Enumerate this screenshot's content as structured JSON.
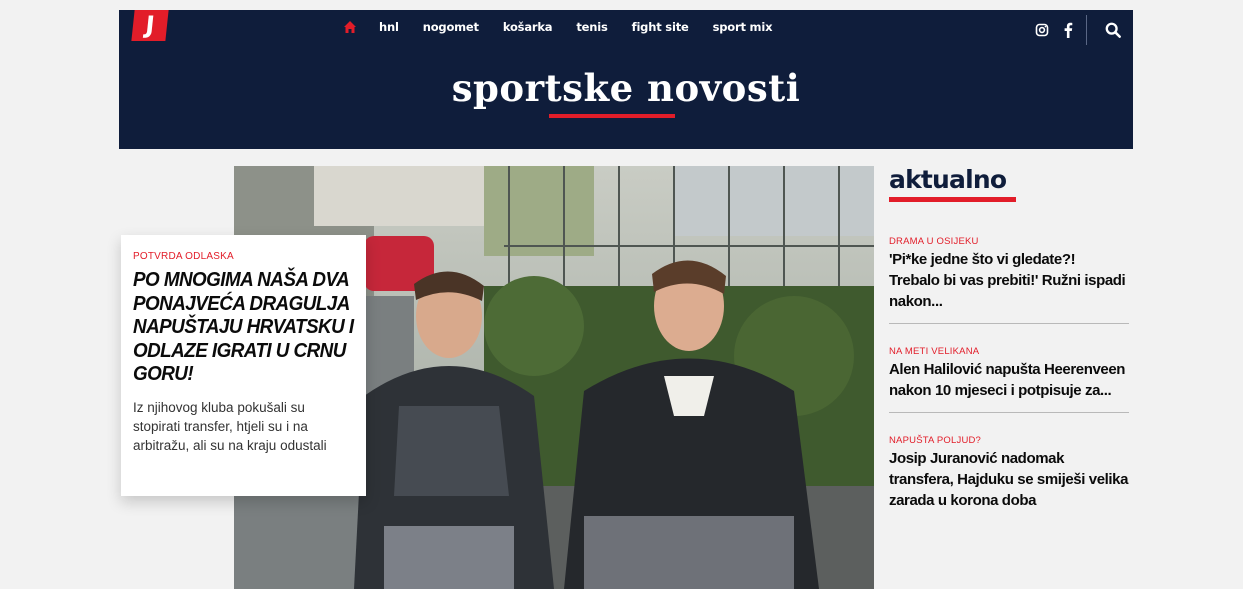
{
  "header": {
    "logo": "J",
    "nav": [
      {
        "label": "hnl"
      },
      {
        "label": "nogomet"
      },
      {
        "label": "košarka"
      },
      {
        "label": "tenis"
      },
      {
        "label": "fight site"
      },
      {
        "label": "sport mix"
      }
    ],
    "site_title": "sportske novosti",
    "icons": [
      "home-icon",
      "instagram-icon",
      "facebook-icon",
      "search-icon"
    ]
  },
  "hero": {
    "kicker": "POTVRDA ODLASKA",
    "headline": "PO MNOGIMA NAŠA DVA PONAJVEĆA DRAGULJA NAPUŠTAJU HRVATSKU I ODLAZE IGRATI U CRNU GORU!",
    "subtitle": "Iz njihovog kluba pokušali su stopirati transfer, htjeli su i na arbitražu, ali su na kraju odustali"
  },
  "sidebar": {
    "title": "aktualno",
    "articles": [
      {
        "kicker": "DRAMA U OSIJEKU",
        "headline": "'Pi*ke jedne što vi gledate?! Trebalo bi vas prebiti!' Ružni ispadi nakon..."
      },
      {
        "kicker": "NA METI VELIKANA",
        "headline": "Alen Halilović napušta Heerenveen nakon 10 mjeseci i potpisuje za..."
      },
      {
        "kicker": "NAPUŠTA POLJUD?",
        "headline": "Josip Juranović nadomak transfera, Hajduku se smiješi velika zarada u korona doba"
      }
    ]
  },
  "colors": {
    "navy": "#0f1d3b",
    "accent_red": "#e21d29",
    "background": "#f2f2f2"
  }
}
